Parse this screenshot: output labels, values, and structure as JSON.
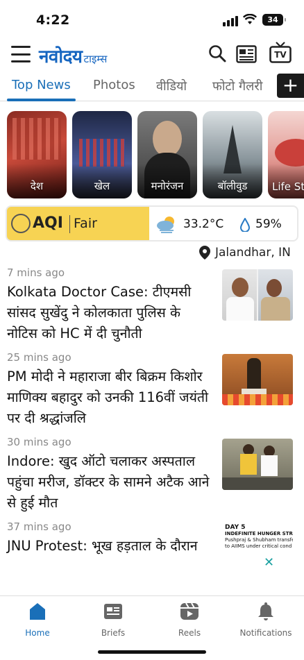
{
  "status_bar": {
    "time": "4:22",
    "battery": "34"
  },
  "header": {
    "logo_main": "नवोदय",
    "logo_sub": "टाइम्स",
    "tv_label": "TV"
  },
  "tabs": [
    {
      "label": "Top News",
      "active": true
    },
    {
      "label": "Photos"
    },
    {
      "label": "वीडियो"
    },
    {
      "label": "फोटो गैलरी"
    }
  ],
  "categories": [
    {
      "label": "देश",
      "color": "#b23a2e"
    },
    {
      "label": "खेल",
      "color": "#3b4a7a"
    },
    {
      "label": "मनोरंजन",
      "color": "#4a4a4a"
    },
    {
      "label": "बॉलीवुड",
      "color": "#6c7a80"
    },
    {
      "label": "Life St",
      "color": "#e8b4b0"
    }
  ],
  "aqi": {
    "label": "AQI",
    "value": "Fair",
    "temperature": "33.2°C",
    "humidity": "59%",
    "accent": "#f7d353"
  },
  "location": "Jalandhar, IN",
  "news": [
    {
      "ago": "7 mins ago",
      "headline": "Kolkata Doctor Case: टीएमसी सांसद सुखेंदु ने कोलकाता पुलिस के नोटिस को HC में दी चुनौती"
    },
    {
      "ago": "25 mins ago",
      "headline": "PM मोदी ने महाराजा बीर बिक्रम किशोर माणिक्य बहादुर को उनकी 116वीं जयंती पर दी श्रद्धांजलि"
    },
    {
      "ago": "30 mins ago",
      "headline": "Indore: खुद ऑटो चलाकर अस्पताल पहुंचा मरीज, डॉक्टर के सामने अटैक आने से हुई मौत"
    },
    {
      "ago": "37 mins ago",
      "headline": "JNU Protest: भूख हड़ताल के दौरान"
    }
  ],
  "thumb4_text": {
    "line1": "DAY 5",
    "line2": "INDEFINITE HUNGER STR",
    "line3": "Pushpraj & Shubham transfer",
    "line4": "to AIIMS under critical cond"
  },
  "bottom_nav": [
    {
      "label": "Home",
      "active": true
    },
    {
      "label": "Briefs"
    },
    {
      "label": "Reels"
    },
    {
      "label": "Notifications"
    }
  ]
}
